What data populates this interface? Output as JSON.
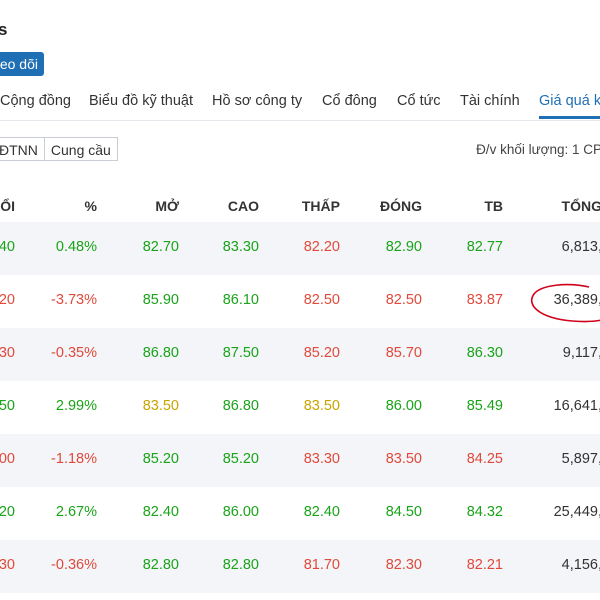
{
  "header": {
    "title": "s",
    "follow_label": "eo dõi"
  },
  "tabs": [
    {
      "label": "Cộng đồng"
    },
    {
      "label": "Biểu đồ kỹ thuật"
    },
    {
      "label": "Hồ sơ công ty"
    },
    {
      "label": "Cổ đông"
    },
    {
      "label": "Cổ tức"
    },
    {
      "label": "Tài chính"
    },
    {
      "label": "Giá quá k"
    }
  ],
  "toolbar": {
    "gdtnn_label": "ĐTNN",
    "cung_cau_label": "Cung cầu",
    "unit_text": "Đ/v khối lượng: 1 CP"
  },
  "columns": [
    "ỔI",
    "%",
    "MỞ",
    "CAO",
    "THẤP",
    "ĐÓNG",
    "TB",
    "TỔNG"
  ],
  "rows": [
    {
      "change": "40",
      "pct": "0.48%",
      "open": "82.70",
      "high": "83.30",
      "low": "82.20",
      "close": "82.90",
      "avg": "82.77",
      "total": "6,813,"
    },
    {
      "change": "20",
      "pct": "-3.73%",
      "open": "85.90",
      "high": "86.10",
      "low": "82.50",
      "close": "82.50",
      "avg": "83.87",
      "total": "36,389,"
    },
    {
      "change": "30",
      "pct": "-0.35%",
      "open": "86.80",
      "high": "87.50",
      "low": "85.20",
      "close": "85.70",
      "avg": "86.30",
      "total": "9,117,"
    },
    {
      "change": "50",
      "pct": "2.99%",
      "open": "83.50",
      "high": "86.80",
      "low": "83.50",
      "close": "86.00",
      "avg": "85.49",
      "total": "16,641,"
    },
    {
      "change": "00",
      "pct": "-1.18%",
      "open": "85.20",
      "high": "85.20",
      "low": "83.30",
      "close": "83.50",
      "avg": "84.25",
      "total": "5,897,"
    },
    {
      "change": "20",
      "pct": "2.67%",
      "open": "82.40",
      "high": "86.00",
      "low": "82.40",
      "close": "84.50",
      "avg": "84.32",
      "total": "25,449,"
    },
    {
      "change": "30",
      "pct": "-0.36%",
      "open": "82.80",
      "high": "82.80",
      "low": "81.70",
      "close": "82.30",
      "avg": "82.21",
      "total": "4,156,"
    }
  ],
  "row_colors": [
    {
      "change": "green",
      "pct": "green",
      "open": "green",
      "high": "green",
      "low": "red",
      "close": "green",
      "avg": "green"
    },
    {
      "change": "red",
      "pct": "red",
      "open": "green",
      "high": "green",
      "low": "red",
      "close": "red",
      "avg": "red"
    },
    {
      "change": "red",
      "pct": "red",
      "open": "green",
      "high": "green",
      "low": "red",
      "close": "red",
      "avg": "green"
    },
    {
      "change": "green",
      "pct": "green",
      "open": "yellow",
      "high": "green",
      "low": "yellow",
      "close": "green",
      "avg": "green"
    },
    {
      "change": "red",
      "pct": "red",
      "open": "green",
      "high": "green",
      "low": "red",
      "close": "red",
      "avg": "red"
    },
    {
      "change": "green",
      "pct": "green",
      "open": "green",
      "high": "green",
      "low": "green",
      "close": "green",
      "avg": "green"
    },
    {
      "change": "red",
      "pct": "red",
      "open": "green",
      "high": "green",
      "low": "red",
      "close": "red",
      "avg": "red"
    }
  ],
  "colors": {
    "accent": "#1f6fb5",
    "up": "#19a319",
    "down": "#e0493b",
    "ref": "#c9a400",
    "annotation": "#d0021b"
  }
}
